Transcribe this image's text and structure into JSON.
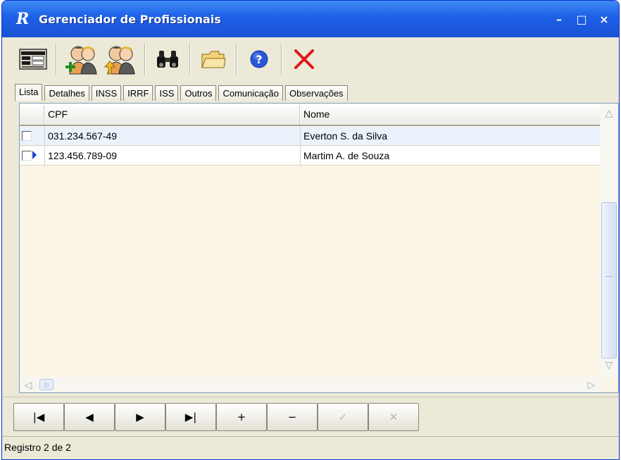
{
  "window": {
    "title": "Gerenciador de Profissionais",
    "app_icon_glyph": "R",
    "controls": {
      "minimize": "–",
      "maximize": "□",
      "close": "×"
    }
  },
  "toolbar": {
    "buttons": [
      {
        "icon": "form-view-icon"
      },
      {
        "icon": "add-professional-icon"
      },
      {
        "icon": "edit-professional-icon"
      },
      {
        "icon": "binoculars-search-icon"
      },
      {
        "icon": "open-folder-icon"
      },
      {
        "icon": "help-icon"
      },
      {
        "icon": "close-red-x-icon"
      }
    ]
  },
  "tabs": [
    {
      "label": "Lista",
      "active": true
    },
    {
      "label": "Detalhes"
    },
    {
      "label": "INSS"
    },
    {
      "label": "IRRF"
    },
    {
      "label": "ISS"
    },
    {
      "label": "Outros"
    },
    {
      "label": "Comunicação"
    },
    {
      "label": "Observações"
    }
  ],
  "grid": {
    "columns": [
      "CPF",
      "Nome"
    ],
    "rows": [
      {
        "cpf": "031.234.567-49",
        "nome": "Everton S. da Silva",
        "current": false
      },
      {
        "cpf": "123.456.789-09",
        "nome": "Martim A. de Souza",
        "current": true
      }
    ]
  },
  "navigator": {
    "first": "|◀",
    "prior": "◀",
    "next": "▶",
    "last": "▶|",
    "insert": "+",
    "delete": "−",
    "post": "✓",
    "cancel": "✕"
  },
  "status": {
    "text": "Registro 2 de 2"
  },
  "colors": {
    "title_bar": "#1d5fe6",
    "grid_bg": "#fbf5e6",
    "row_alt": "#eaf2fb",
    "pointer": "#1a3fd0",
    "delete_x": "#e01818"
  }
}
